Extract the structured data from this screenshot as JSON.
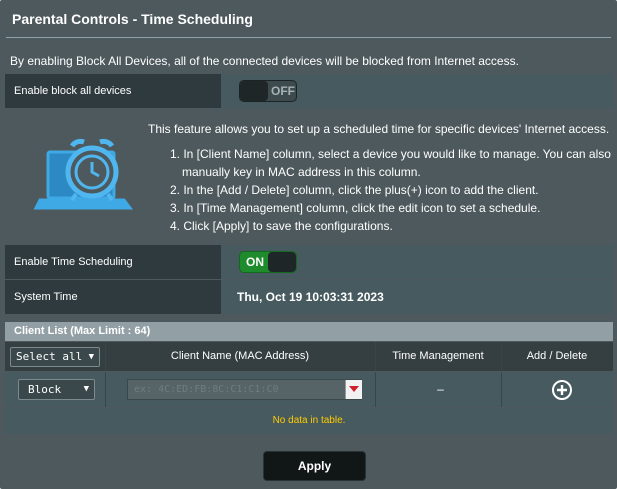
{
  "page": {
    "title": "Parental Controls - Time Scheduling",
    "description": "By enabling Block All Devices, all of the connected devices will be blocked from Internet access."
  },
  "block_all": {
    "label": "Enable block all devices",
    "toggle_text": "OFF",
    "state": "off"
  },
  "info": {
    "heading": "This feature allows you to set up a scheduled time for specific devices' Internet access.",
    "steps": [
      "1. In [Client Name] column, select a device you would like to manage. You can also",
      "manually key in MAC address in this column.",
      "2. In the [Add / Delete] column, click the plus(+) icon to add the client.",
      "3. In [Time Management] column, click the edit icon to set a schedule.",
      "4. Click [Apply] to save the configurations."
    ],
    "icon": "alarm-clock-laptop-icon"
  },
  "time_scheduling": {
    "label": "Enable Time Scheduling",
    "toggle_text": "ON",
    "state": "on"
  },
  "system_time": {
    "label": "System Time",
    "value": "Thu, Oct 19 10:03:31 2023"
  },
  "client_list": {
    "title": "Client List (Max Limit : 64)",
    "select_all": "Select all",
    "columns": {
      "client_name": "Client Name (MAC Address)",
      "time_management": "Time Management",
      "add_delete": "Add / Delete"
    },
    "row": {
      "mode": "Block",
      "mac_placeholder": "ex: 4C:ED:FB:8C:C1:C1:C0",
      "time_management": "–"
    },
    "empty_text": "No data in table."
  },
  "actions": {
    "apply": "Apply"
  },
  "colors": {
    "panel": "#4d595d",
    "toggle_on": "#1e8b2c",
    "empty_text": "#ffcc00"
  }
}
